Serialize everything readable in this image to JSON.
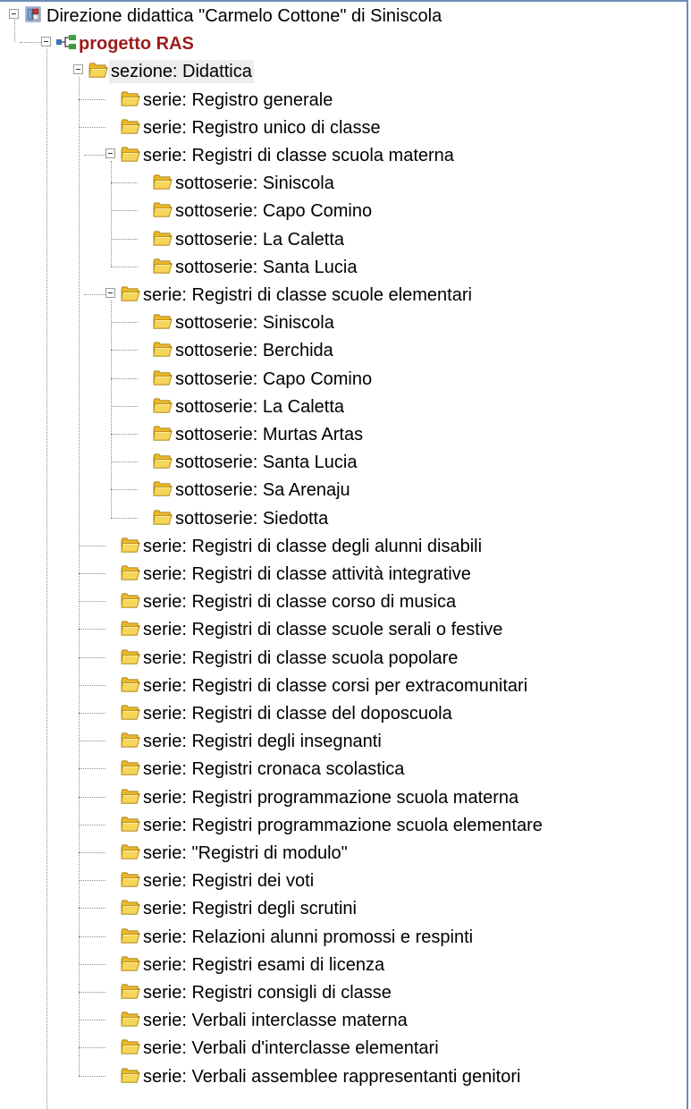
{
  "tree": {
    "root": {
      "label": "Direzione didattica \"Carmelo Cottone\" di Siniscola",
      "icon": "archive-icon"
    },
    "project": {
      "label": "progetto RAS",
      "icon": "hierarchy-icon",
      "color": "#9b1c1c"
    },
    "section": {
      "label": "sezione: Didattica",
      "icon": "folder-icon"
    },
    "series": [
      {
        "label": "serie: Registro generale"
      },
      {
        "label": "serie: Registro unico di classe"
      },
      {
        "label": "serie: Registri di classe scuola materna",
        "expanded": true,
        "children": [
          {
            "label": "sottoserie: Siniscola"
          },
          {
            "label": "sottoserie: Capo Comino"
          },
          {
            "label": "sottoserie: La Caletta"
          },
          {
            "label": "sottoserie: Santa Lucia"
          }
        ]
      },
      {
        "label": "serie: Registri di classe scuole elementari",
        "expanded": true,
        "children": [
          {
            "label": "sottoserie: Siniscola"
          },
          {
            "label": "sottoserie: Berchida"
          },
          {
            "label": "sottoserie: Capo Comino"
          },
          {
            "label": "sottoserie: La Caletta"
          },
          {
            "label": "sottoserie: Murtas Artas"
          },
          {
            "label": "sottoserie: Santa Lucia"
          },
          {
            "label": "sottoserie: Sa Arenaju"
          },
          {
            "label": "sottoserie: Siedotta"
          }
        ]
      },
      {
        "label": "serie: Registri di classe degli alunni disabili"
      },
      {
        "label": "serie: Registri di classe attività integrative"
      },
      {
        "label": "serie: Registri di classe corso di musica"
      },
      {
        "label": "serie: Registri di classe scuole serali o festive"
      },
      {
        "label": "serie: Registri di classe scuola popolare"
      },
      {
        "label": "serie: Registri di classe corsi per extracomunitari"
      },
      {
        "label": "serie: Registri di classe del doposcuola"
      },
      {
        "label": "serie: Registri degli insegnanti"
      },
      {
        "label": "serie: Registri cronaca scolastica"
      },
      {
        "label": "serie: Registri programmazione scuola materna"
      },
      {
        "label": "serie: Registri programmazione scuola elementare"
      },
      {
        "label": "serie: \"Registri di modulo\""
      },
      {
        "label": "serie: Registri dei voti"
      },
      {
        "label": "serie: Registri degli scrutini"
      },
      {
        "label": "serie: Relazioni alunni promossi e respinti"
      },
      {
        "label": "serie: Registri esami di licenza"
      },
      {
        "label": "serie: Registri consigli di classe"
      },
      {
        "label": "serie: Verbali interclasse materna"
      },
      {
        "label": "serie: Verbali d'interclasse elementari"
      },
      {
        "label": "serie: Verbali assemblee rappresentanti genitori"
      }
    ]
  },
  "colors": {
    "frame": "#6b8db5",
    "selected_bg": "#ededed",
    "project_text": "#9b1c1c",
    "folder": "#f2cd3c"
  }
}
